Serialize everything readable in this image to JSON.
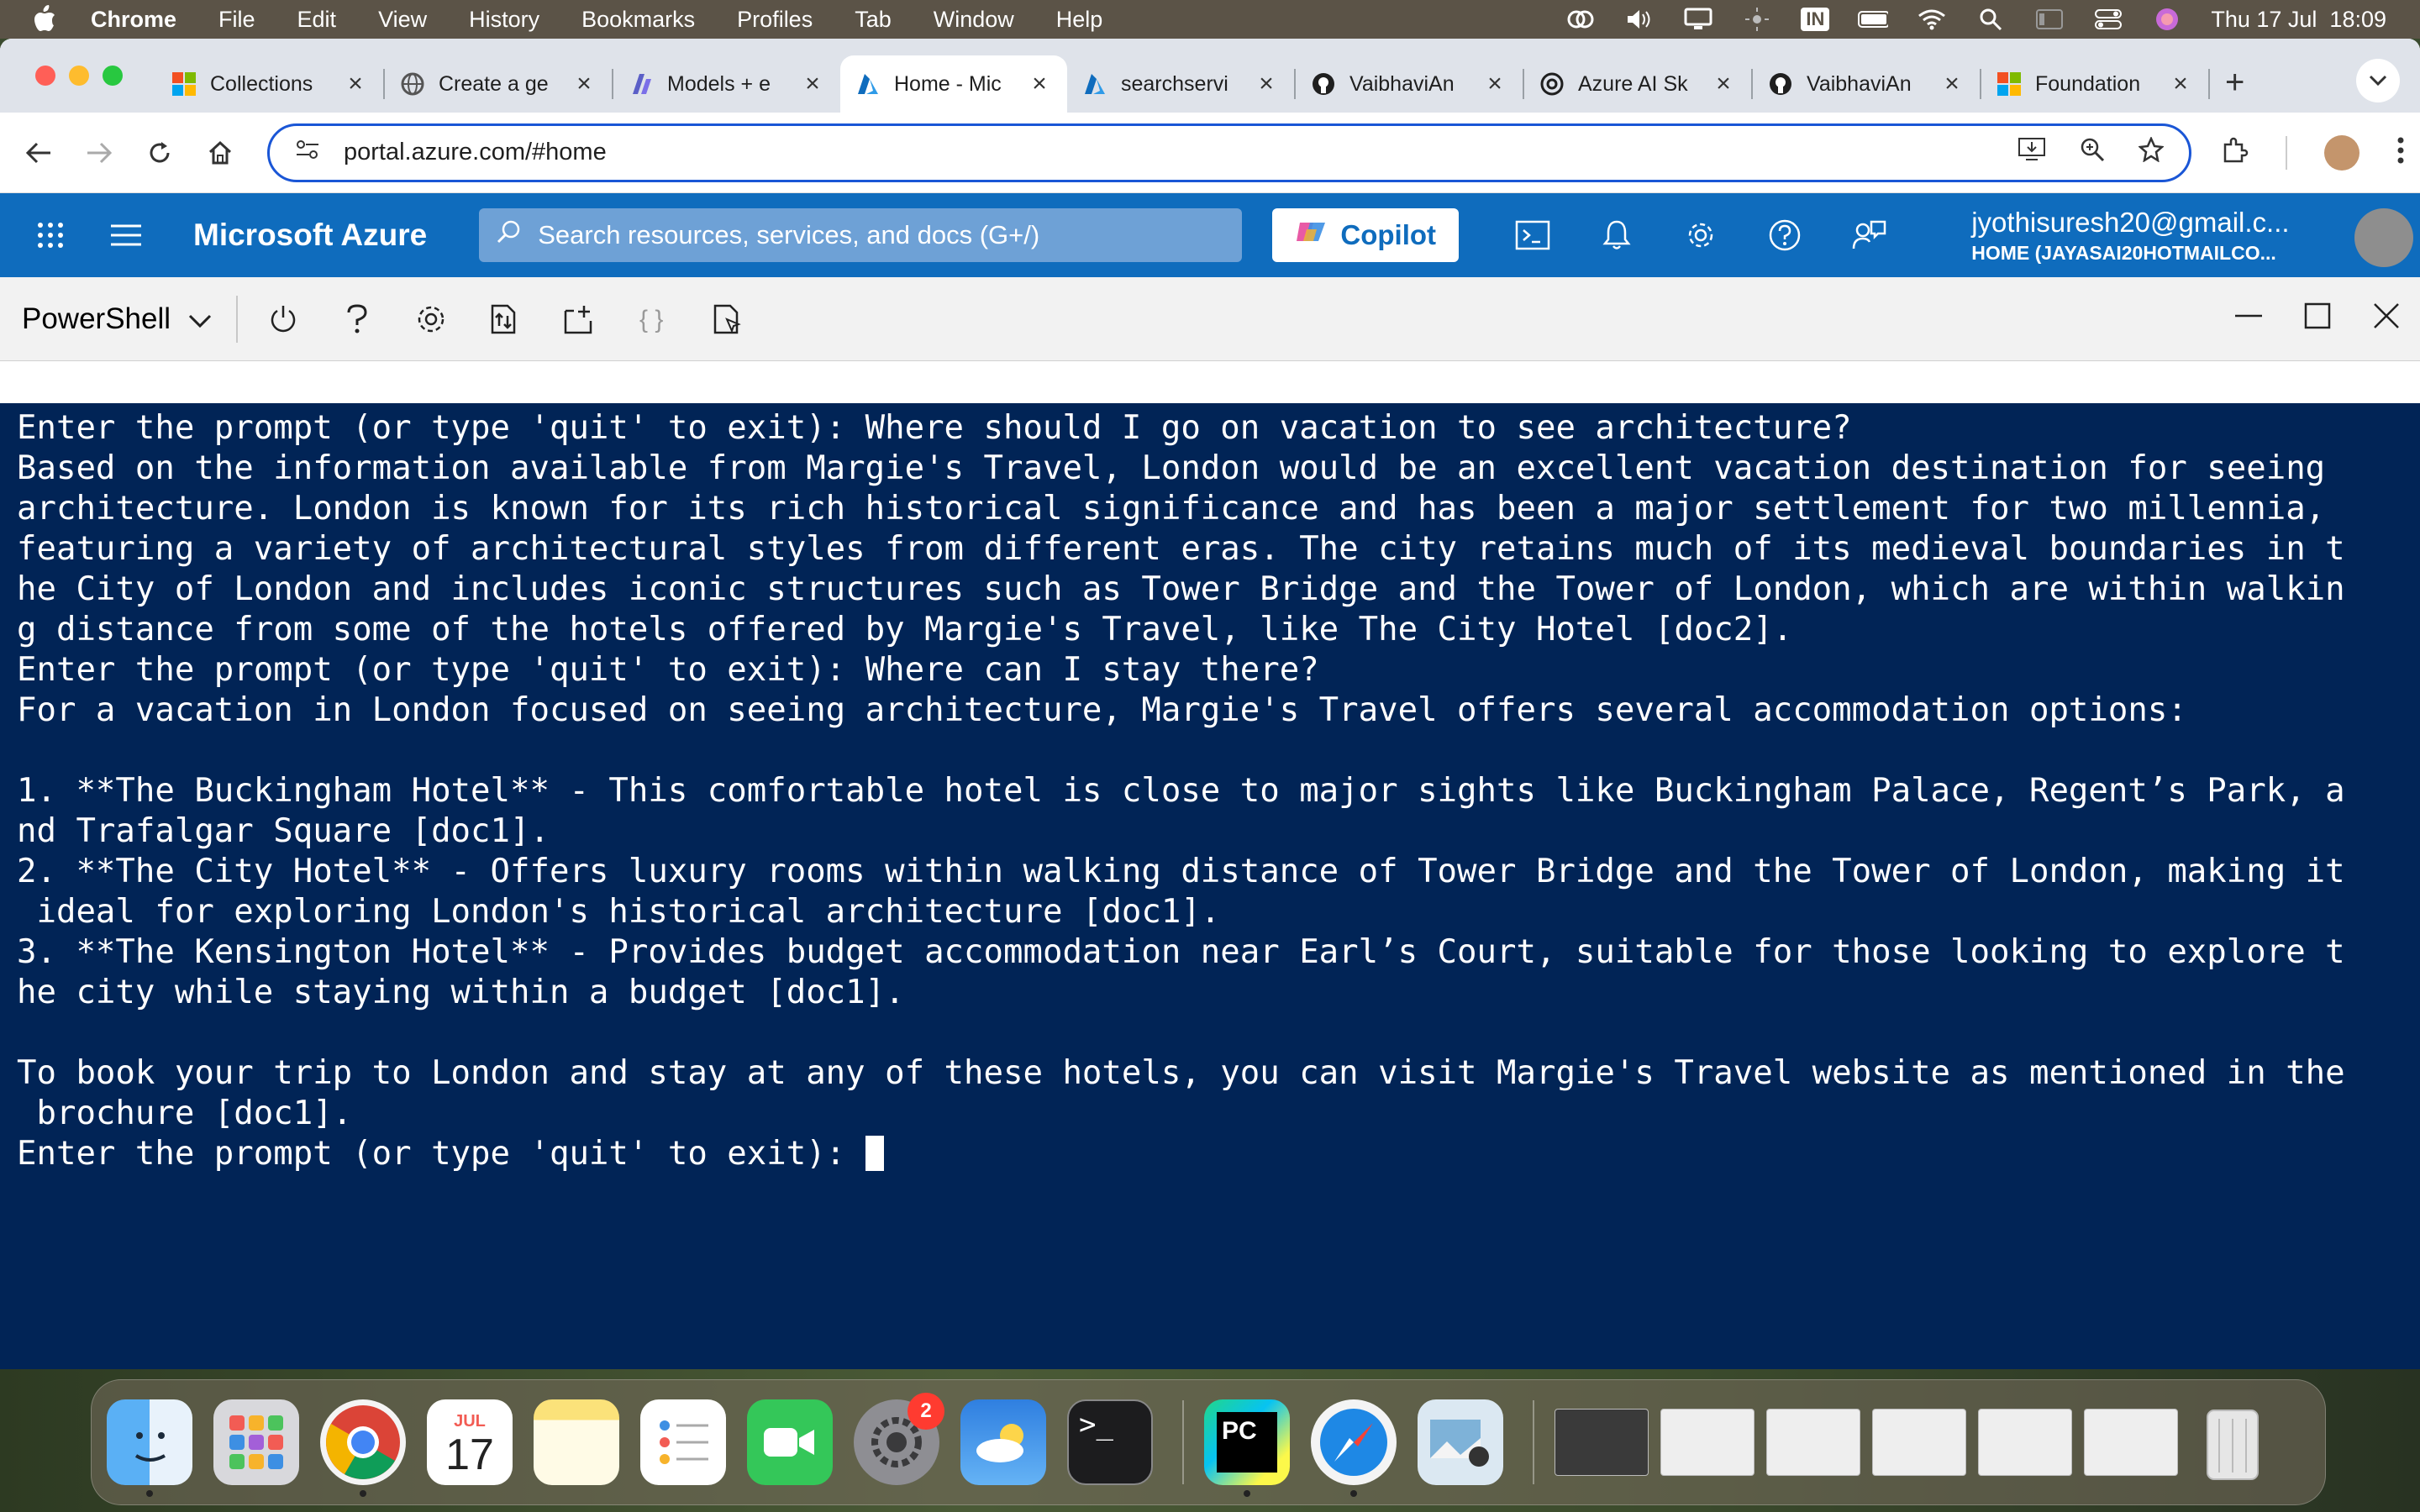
{
  "menubar": {
    "app": "Chrome",
    "items": [
      "File",
      "Edit",
      "View",
      "History",
      "Bookmarks",
      "Profiles",
      "Tab",
      "Window",
      "Help"
    ],
    "input_source": "IN",
    "clock": "Thu 17 Jul  18:09"
  },
  "tabs": [
    {
      "title": "Collections",
      "favicon": "microsoft-icon"
    },
    {
      "title": "Create a ge",
      "favicon": "globe-icon"
    },
    {
      "title": "Models + e",
      "favicon": "foundry-icon"
    },
    {
      "title": "Home - Mic",
      "favicon": "azure-icon"
    },
    {
      "title": "searchservi",
      "favicon": "azure-icon"
    },
    {
      "title": "VaibhaviAn",
      "favicon": "github-icon"
    },
    {
      "title": "Azure AI Sk",
      "favicon": "openai-icon"
    },
    {
      "title": "VaibhaviAn",
      "favicon": "github-icon"
    },
    {
      "title": "Foundation",
      "favicon": "microsoft-icon"
    }
  ],
  "omnibox": {
    "url": "portal.azure.com/#home"
  },
  "azure": {
    "brand": "Microsoft Azure",
    "search_placeholder": "Search resources, services, and docs (G+/)",
    "copilot_label": "Copilot",
    "account_email": "jyothisuresh20@gmail.c...",
    "account_tenant": "HOME (JAYASAI20HOTMAILCO...",
    "handle_dots": "..."
  },
  "shell": {
    "environment": "PowerShell"
  },
  "terminal": {
    "lines": [
      "Enter the prompt (or type 'quit' to exit): Where should I go on vacation to see architecture?",
      "Based on the information available from Margie's Travel, London would be an excellent vacation destination for seeing",
      "architecture. London is known for its rich historical significance and has been a major settlement for two millennia,",
      "featuring a variety of architectural styles from different eras. The city retains much of its medieval boundaries in t",
      "he City of London and includes iconic structures such as Tower Bridge and the Tower of London, which are within walkin",
      "g distance from some of the hotels offered by Margie's Travel, like The City Hotel [doc2].",
      "Enter the prompt (or type 'quit' to exit): Where can I stay there?",
      "For a vacation in London focused on seeing architecture, Margie's Travel offers several accommodation options:",
      "",
      "1. **The Buckingham Hotel** - This comfortable hotel is close to major sights like Buckingham Palace, Regent’s Park, a",
      "nd Trafalgar Square [doc1].",
      "2. **The City Hotel** - Offers luxury rooms within walking distance of Tower Bridge and the Tower of London, making it",
      " ideal for exploring London's historical architecture [doc1].",
      "3. **The Kensington Hotel** - Provides budget accommodation near Earl’s Court, suitable for those looking to explore t",
      "he city while staying within a budget [doc1].",
      "",
      "To book your trip to London and stay at any of these hotels, you can visit Margie's Travel website as mentioned in the",
      " brochure [doc1]."
    ],
    "prompt": "Enter the prompt (or type 'quit' to exit): "
  },
  "dock": {
    "calendar_month": "JUL",
    "calendar_day": "17",
    "settings_badge": "2",
    "terminal_glyph": ">_",
    "pycharm_label": "PC"
  },
  "colors": {
    "azure_blue": "#0f6cbd",
    "terminal_bg": "#012456",
    "menubar_bg": "#5b5347"
  }
}
